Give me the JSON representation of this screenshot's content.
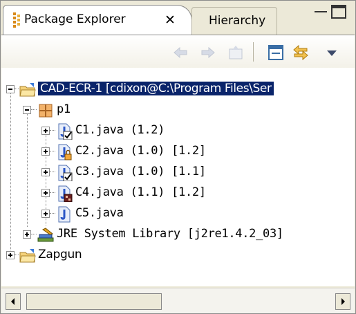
{
  "tabs": {
    "active_label": "Package Explorer",
    "close_glyph": "✕",
    "inactive_label": "Hierarchy"
  },
  "toolbar": {
    "buttons": [
      "back-icon",
      "forward-icon",
      "up-icon",
      "collapse-all-icon",
      "link-with-editor-icon",
      "view-menu-icon"
    ]
  },
  "tree": {
    "project": {
      "label": "CAD-ECR-1  [cdixon@C:\\Program Files\\Ser",
      "package": {
        "label": "p1",
        "files": [
          {
            "label": "C1.java  (1.2)"
          },
          {
            "label": "C2.java  (1.0) [1.2]"
          },
          {
            "label": "C3.java  (1.0) [1.1]"
          },
          {
            "label": "C4.java  (1.1) [1.2]"
          },
          {
            "label": "C5.java"
          }
        ]
      },
      "library": {
        "label": "JRE System Library [j2re1.4.2_03]"
      }
    },
    "project2": {
      "label": "Zapgun"
    }
  },
  "colors": {
    "selection": "#0a246a",
    "panel": "#ece9d8"
  }
}
